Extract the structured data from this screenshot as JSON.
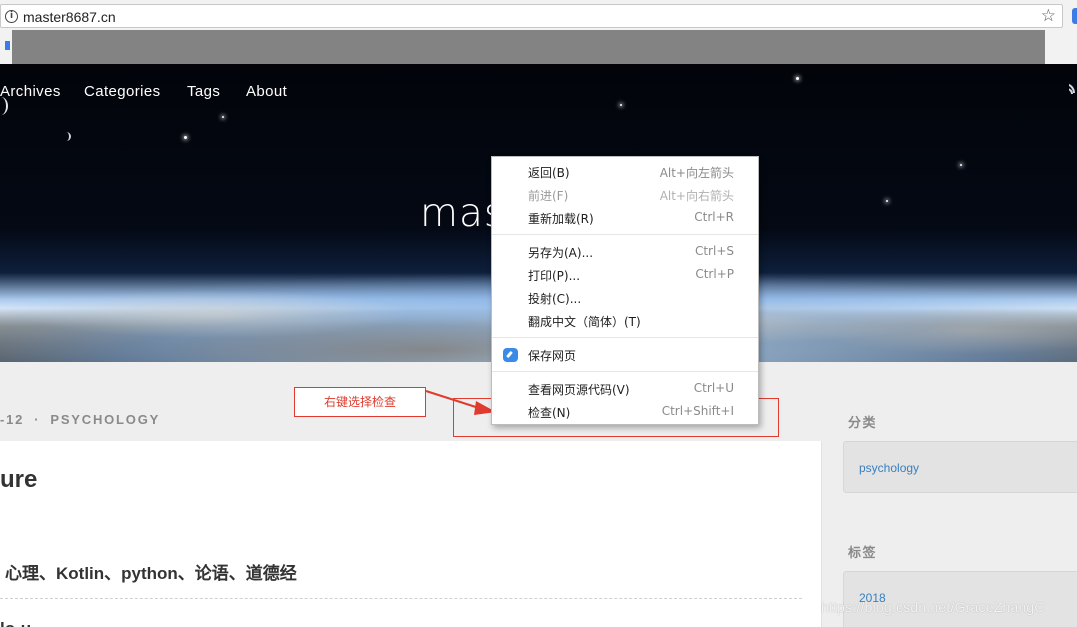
{
  "browser": {
    "url": "master8687.cn"
  },
  "site": {
    "nav": [
      "Archives",
      "Categories",
      "Tags",
      "About"
    ],
    "hero_title_partial": "mast"
  },
  "post": {
    "meta_date_partial": "-12",
    "meta_category": "PSYCHOLOGY",
    "title_partial": "ure",
    "tags_line": "心理、Kotlin、python、论语、道德经",
    "cut_line": "lo·u"
  },
  "sidebar": {
    "categories_heading": "分类",
    "categories": [
      "psychology"
    ],
    "tags_heading": "标签",
    "tags": [
      "2018"
    ]
  },
  "annotation": {
    "note": "右键选择检查",
    "color": "#e03b2e"
  },
  "context_menu": {
    "groups": [
      [
        {
          "label": "返回(B)",
          "shortcut": "Alt+向左箭头",
          "enabled": true
        },
        {
          "label": "前进(F)",
          "shortcut": "Alt+向右箭头",
          "enabled": false
        },
        {
          "label": "重新加载(R)",
          "shortcut": "Ctrl+R",
          "enabled": true
        }
      ],
      [
        {
          "label": "另存为(A)...",
          "shortcut": "Ctrl+S",
          "enabled": true
        },
        {
          "label": "打印(P)...",
          "shortcut": "Ctrl+P",
          "enabled": true
        },
        {
          "label": "投射(C)...",
          "shortcut": "",
          "enabled": true
        },
        {
          "label": "翻成中文（简体）(T)",
          "shortcut": "",
          "enabled": true
        }
      ],
      [
        {
          "label": "保存网页",
          "shortcut": "",
          "enabled": true,
          "icon": "save-page-icon"
        }
      ],
      [
        {
          "label": "查看网页源代码(V)",
          "shortcut": "Ctrl+U",
          "enabled": true
        },
        {
          "label": "检查(N)",
          "shortcut": "Ctrl+Shift+I",
          "enabled": true
        }
      ]
    ]
  },
  "watermark": "https://blog.csdn.net/GraceZhangC"
}
